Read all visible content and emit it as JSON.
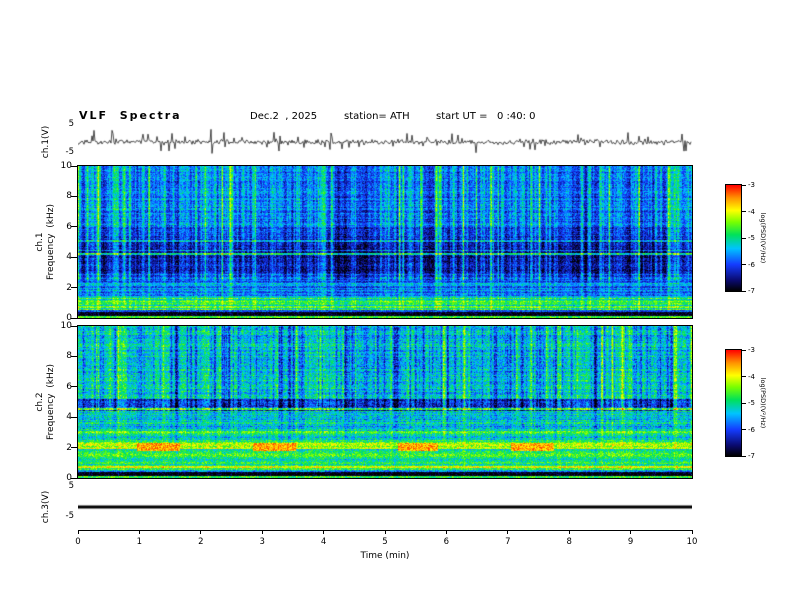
{
  "header": {
    "title": "VLF  Spectra",
    "date": "Dec.2  , 2025",
    "station": "station= ATH",
    "start_ut": "start UT =   0 :40: 0"
  },
  "axes": {
    "time_label": "Time  (min)",
    "time_ticks": [
      "0",
      "1",
      "2",
      "3",
      "4",
      "5",
      "6",
      "7",
      "8",
      "9",
      "10"
    ],
    "freq_ticks": [
      "10",
      "8",
      "6",
      "4",
      "2",
      "0"
    ],
    "volt_max": "5",
    "volt_min": "-5"
  },
  "panels": {
    "ch1_wave_label": "ch.1(V)",
    "ch1_spec_label1": "ch.1",
    "ch1_spec_label2": "Frequency  (kHz)",
    "ch2_spec_label1": "ch.2",
    "ch2_spec_label2": "Frequency  (kHz)",
    "ch3_wave_label": "ch.3(V)"
  },
  "colorbar": {
    "label": "log(PSD)(V²/Hz)",
    "ticks": [
      "-3",
      "-4",
      "-5",
      "-6",
      "-7"
    ],
    "stops": [
      {
        "p": 0.0,
        "c": [
          0,
          0,
          0
        ]
      },
      {
        "p": 0.1,
        "c": [
          10,
          10,
          110
        ]
      },
      {
        "p": 0.25,
        "c": [
          20,
          60,
          255
        ]
      },
      {
        "p": 0.4,
        "c": [
          0,
          195,
          255
        ]
      },
      {
        "p": 0.53,
        "c": [
          0,
          225,
          90
        ]
      },
      {
        "p": 0.65,
        "c": [
          120,
          255,
          0
        ]
      },
      {
        "p": 0.76,
        "c": [
          255,
          255,
          0
        ]
      },
      {
        "p": 0.88,
        "c": [
          255,
          145,
          0
        ]
      },
      {
        "p": 1.0,
        "c": [
          255,
          0,
          0
        ]
      }
    ]
  },
  "chart_data": [
    {
      "type": "line",
      "panel": "ch1-waveform",
      "canvas": "wave-ch1",
      "xlabel": "Time (min)",
      "ylabel": "ch.1(V)",
      "xlim": [
        0,
        10
      ],
      "ylim": [
        -5,
        5
      ],
      "description": "channel-1 voltage: dense noise ~±1 V about 0 V with frequent impulsive sferic spikes to ±4 V over the full 10 minutes",
      "seed": 20251202,
      "sigma": 0.35,
      "spike_prob": 0.09,
      "spike_amp": 3.2
    },
    {
      "type": "heatmap",
      "panel": "ch1-spectrogram",
      "canvas": "spec-ch1",
      "xlabel": "Time (min)",
      "ylabel": "ch.1 Frequency (kHz)",
      "zlabel": "log(PSD)(V²/Hz)",
      "xlim": [
        0,
        10
      ],
      "ylim": [
        0,
        10
      ],
      "zlim": [
        -7,
        -3
      ],
      "description": "blue background (~-6) with dense bright vertical sferic streaks, dark navy band 3-5 kHz, green/yellow banding below 1.3 kHz, black gap near 0.3 kHz",
      "seed": 11,
      "pix_noise": 0.42,
      "base_bands": [
        {
          "f": [
            6.0,
            10.01
          ],
          "level": -5.95,
          "rj": 0.25
        },
        {
          "f": [
            5.2,
            6.0
          ],
          "level": -6.25,
          "rj": 0.2
        },
        {
          "f": [
            2.9,
            5.2
          ],
          "level": -6.6,
          "rj": 0.2
        },
        {
          "f": [
            2.0,
            2.9
          ],
          "level": -6.15,
          "rj": 0.3
        },
        {
          "f": [
            1.3,
            2.0
          ],
          "level": -5.75,
          "rj": 0.45
        },
        {
          "f": [
            0.5,
            1.3
          ],
          "level": -5.0,
          "rj": 0.5
        },
        {
          "f": [
            0.42,
            0.5
          ],
          "level": -5.8,
          "rj": 0.2
        },
        {
          "f": [
            0.14,
            0.42
          ],
          "level": -7.0,
          "rj": 0.03
        },
        {
          "f": [
            0.0,
            0.14
          ],
          "level": -4.75,
          "rj": 0.1
        }
      ],
      "lines": [
        {
          "f": 4.2,
          "w": 0.07,
          "level": -5.3
        },
        {
          "f": 4.45,
          "w": 0.05,
          "level": -5.8
        },
        {
          "f": 5.05,
          "w": 0.05,
          "level": -5.6
        },
        {
          "f": 2.2,
          "w": 0.08,
          "level": -5.5
        },
        {
          "f": 1.15,
          "w": 0.06,
          "level": -4.9
        },
        {
          "f": 0.75,
          "w": 0.06,
          "level": -4.6
        }
      ],
      "gain": [
        {
          "f": [
            2.5,
            10.01
          ],
          "g": 1.0
        },
        {
          "f": [
            0.5,
            2.5
          ],
          "g": 0.45
        },
        {
          "f": [
            0.0,
            0.5
          ],
          "g": 0.12
        }
      ],
      "streaks": {
        "base": 0.3,
        "pos_prob": 0.4,
        "pos_amp": 1.3,
        "big_prob": 0.06,
        "big_amp": 1.8,
        "neg_prob": 0.1,
        "neg_amp": 0.5
      },
      "patches": []
    },
    {
      "type": "heatmap",
      "panel": "ch2-spectrogram",
      "canvas": "spec-ch2",
      "xlabel": "Time (min)",
      "ylabel": "ch.2 Frequency (kHz)",
      "zlabel": "log(PSD)(V²/Hz)",
      "xlim": [
        0,
        10
      ],
      "ylim": [
        0,
        10
      ],
      "zlim": [
        -7,
        -3
      ],
      "description": "green background (~-5) with blue vertical streaks above 5 kHz, yellow/orange horizontal lines below 4 kHz, dark-red patches near 2 kHz around 1.3, 3.2, 5.5 and 7.4 min, black gap near 0.3 kHz",
      "seed": 22,
      "pix_noise": 0.5,
      "base_bands": [
        {
          "f": [
            5.2,
            10.01
          ],
          "level": -5.15,
          "rj": 0.3
        },
        {
          "f": [
            4.4,
            5.2
          ],
          "level": -5.9,
          "rj": 0.25
        },
        {
          "f": [
            3.3,
            4.4
          ],
          "level": -5.3,
          "rj": 0.35
        },
        {
          "f": [
            2.5,
            3.3
          ],
          "level": -5.0,
          "rj": 0.4
        },
        {
          "f": [
            1.3,
            2.5
          ],
          "level": -4.85,
          "rj": 0.45
        },
        {
          "f": [
            0.5,
            1.3
          ],
          "level": -4.95,
          "rj": 0.5
        },
        {
          "f": [
            0.42,
            0.5
          ],
          "level": -5.6,
          "rj": 0.2
        },
        {
          "f": [
            0.14,
            0.42
          ],
          "level": -7.0,
          "rj": 0.03
        },
        {
          "f": [
            0.0,
            0.14
          ],
          "level": -4.7,
          "rj": 0.1
        }
      ],
      "lines": [
        {
          "f": 4.55,
          "w": 0.07,
          "level": -4.4
        },
        {
          "f": 3.6,
          "w": 0.05,
          "level": -4.9
        },
        {
          "f": 3.05,
          "w": 0.07,
          "level": -4.5
        },
        {
          "f": 2.2,
          "w": 0.09,
          "level": -4.2
        },
        {
          "f": 1.95,
          "w": 0.07,
          "level": -4.15
        },
        {
          "f": 1.5,
          "w": 0.05,
          "level": -4.6
        },
        {
          "f": 0.72,
          "w": 0.08,
          "level": -4.0
        }
      ],
      "gain": [
        {
          "f": [
            4.4,
            10.01
          ],
          "g": 1.0
        },
        {
          "f": [
            2.5,
            4.4
          ],
          "g": 0.45
        },
        {
          "f": [
            0.0,
            2.5
          ],
          "g": 0.22
        }
      ],
      "streaks": {
        "base": 0.25,
        "pos_prob": 0.12,
        "pos_amp": 0.9,
        "big_prob": 0.03,
        "big_amp": 1.2,
        "neg_prob": 0.25,
        "neg_amp": 1.4
      },
      "patches": [
        {
          "t": [
            0.95,
            1.65
          ],
          "f": [
            1.8,
            2.3
          ],
          "level": -3.6
        },
        {
          "t": [
            2.85,
            3.55
          ],
          "f": [
            1.8,
            2.3
          ],
          "level": -3.6
        },
        {
          "t": [
            5.2,
            5.85
          ],
          "f": [
            1.8,
            2.3
          ],
          "level": -3.6
        },
        {
          "t": [
            7.05,
            7.75
          ],
          "f": [
            1.8,
            2.3
          ],
          "level": -3.6
        }
      ]
    },
    {
      "type": "line",
      "panel": "ch3-waveform",
      "canvas": "wave-ch3",
      "xlabel": "Time (min)",
      "ylabel": "ch.3(V)",
      "xlim": [
        0,
        10
      ],
      "ylim": [
        -5,
        5
      ],
      "constant": 0,
      "thickness": 3,
      "description": "channel-3 voltage: flat thick line at 0 V (no signal)"
    }
  ]
}
